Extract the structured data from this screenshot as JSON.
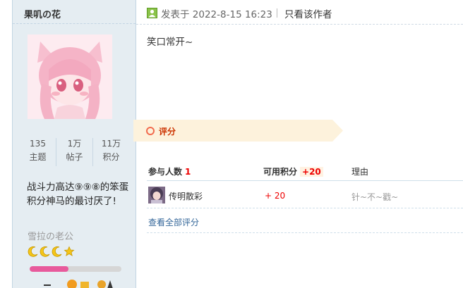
{
  "user": {
    "name": "果叽の花",
    "stats": [
      {
        "value": "135",
        "label": "主题"
      },
      {
        "value": "1万",
        "label": "帖子"
      },
      {
        "value": "11万",
        "label": "积分"
      }
    ],
    "signature": "战斗力高达⑨⑨⑧的笨蛋积分神马的最讨厌了!",
    "custom_title": "雪拉の老公",
    "level_icons": [
      "moon-icon",
      "moon-icon",
      "moon-icon",
      "star-icon"
    ],
    "level_progress": 0.42,
    "colors": {
      "panel": "#e5edf2",
      "level_fill": "#e85a9c"
    }
  },
  "post": {
    "time": "发表于 2022-8-15 16:23",
    "only_author": "只看该作者",
    "content": "笑口常开~"
  },
  "rating": {
    "title": "评分",
    "col_participants": "参与人数",
    "participants_count": "1",
    "col_credits": "可用积分",
    "credits_total": "+20",
    "col_reason": "理由",
    "rows": [
      {
        "name": "传明散彩",
        "score": "+ 20",
        "reason": "针~不~戳~"
      }
    ],
    "view_all": "查看全部评分"
  }
}
